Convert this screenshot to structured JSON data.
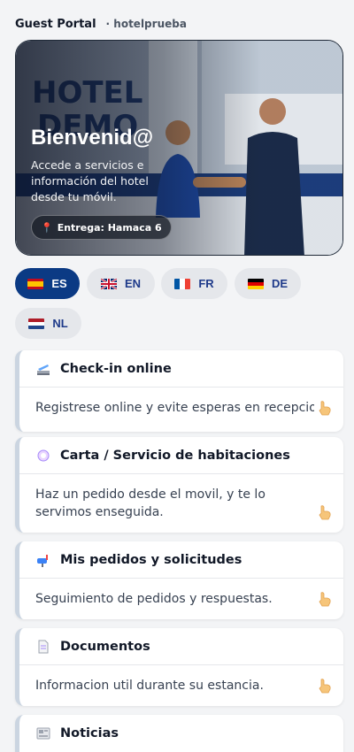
{
  "header": {
    "brand": "Guest Portal",
    "tenant": "· hotelprueba"
  },
  "hero": {
    "title": "Bienvenid@",
    "subtitle": "Accede a servicios e información del hotel desde tu móvil.",
    "delivery": "Entrega: Hamaca 6",
    "sign": "HOTEL DEMO"
  },
  "languages": [
    {
      "code": "ES",
      "active": true
    },
    {
      "code": "EN",
      "active": false
    },
    {
      "code": "FR",
      "active": false
    },
    {
      "code": "DE",
      "active": false
    },
    {
      "code": "NL",
      "active": false
    }
  ],
  "cards": [
    {
      "title": "Check-in online",
      "text": "Registrese online y evite esperas en recepcion.",
      "icon": "check-in-icon"
    },
    {
      "title": "Carta / Servicio de habitaciones",
      "text": "Haz un pedido desde el movil, y te lo servimos enseguida.",
      "icon": "plate-icon"
    },
    {
      "title": "Mis pedidos y solicitudes",
      "text": "Seguimiento de pedidos y respuestas.",
      "icon": "mailbox-icon"
    },
    {
      "title": "Documentos",
      "text": "Informacion util durante su estancia.",
      "icon": "document-icon"
    },
    {
      "title": "Noticias",
      "text": "",
      "icon": "newspaper-icon"
    }
  ]
}
